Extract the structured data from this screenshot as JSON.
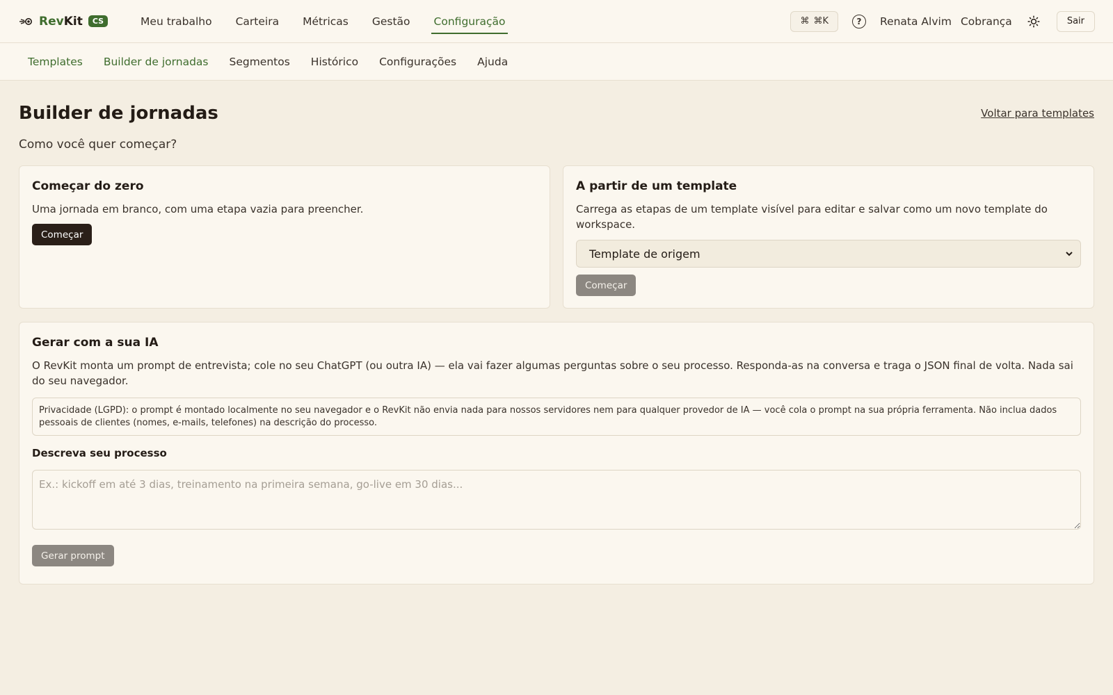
{
  "brand": {
    "name_prefix": "Rev",
    "name_suffix": "Kit",
    "badge": "CS"
  },
  "main_nav": [
    {
      "label": "Meu trabalho",
      "active": false
    },
    {
      "label": "Carteira",
      "active": false
    },
    {
      "label": "Métricas",
      "active": false
    },
    {
      "label": "Gestão",
      "active": false
    },
    {
      "label": "Configuração",
      "active": true
    }
  ],
  "top_right": {
    "shortcut": "⌘K",
    "user": "Renata Alvim",
    "billing": "Cobrança",
    "exit": "Sair"
  },
  "sub_nav": [
    {
      "label": "Templates",
      "highlight": true
    },
    {
      "label": "Builder de jornadas",
      "highlight": true
    },
    {
      "label": "Segmentos",
      "highlight": false
    },
    {
      "label": "Histórico",
      "highlight": false
    },
    {
      "label": "Configurações",
      "highlight": false
    },
    {
      "label": "Ajuda",
      "highlight": false
    }
  ],
  "page": {
    "title": "Builder de jornadas",
    "back_link": "Voltar para templates",
    "subtitle": "Como você quer começar?"
  },
  "card_scratch": {
    "title": "Começar do zero",
    "description": "Uma jornada em branco, com uma etapa vazia para preencher.",
    "button": "Começar"
  },
  "card_template": {
    "title": "A partir de um template",
    "description": "Carrega as etapas de um template visível para editar e salvar como um novo template do workspace.",
    "select_value": "Template de origem",
    "button": "Começar"
  },
  "card_ai": {
    "title": "Gerar com a sua IA",
    "description": "O RevKit monta um prompt de entrevista; cole no seu ChatGPT (ou outra IA) — ela vai fazer algumas perguntas sobre o seu processo. Responda-as na conversa e traga o JSON final de volta. Nada sai do seu navegador.",
    "privacy": "Privacidade (LGPD): o prompt é montado localmente no seu navegador e o RevKit não envia nada para nossos servidores nem para qualquer provedor de IA — você cola o prompt na sua própria ferramenta. Não inclua dados pessoais de clientes (nomes, e-mails, telefones) na descrição do processo.",
    "field_label": "Descreva seu processo",
    "placeholder": "Ex.: kickoff em até 3 dias, treinamento na primeira semana, go-live em 30 dias...",
    "button": "Gerar prompt"
  },
  "colors": {
    "accent": "#3f6d2e",
    "background": "#f4eee2",
    "surface": "#fbf7ef",
    "dark_button": "#2a1f18",
    "disabled_button": "#8c8781"
  }
}
